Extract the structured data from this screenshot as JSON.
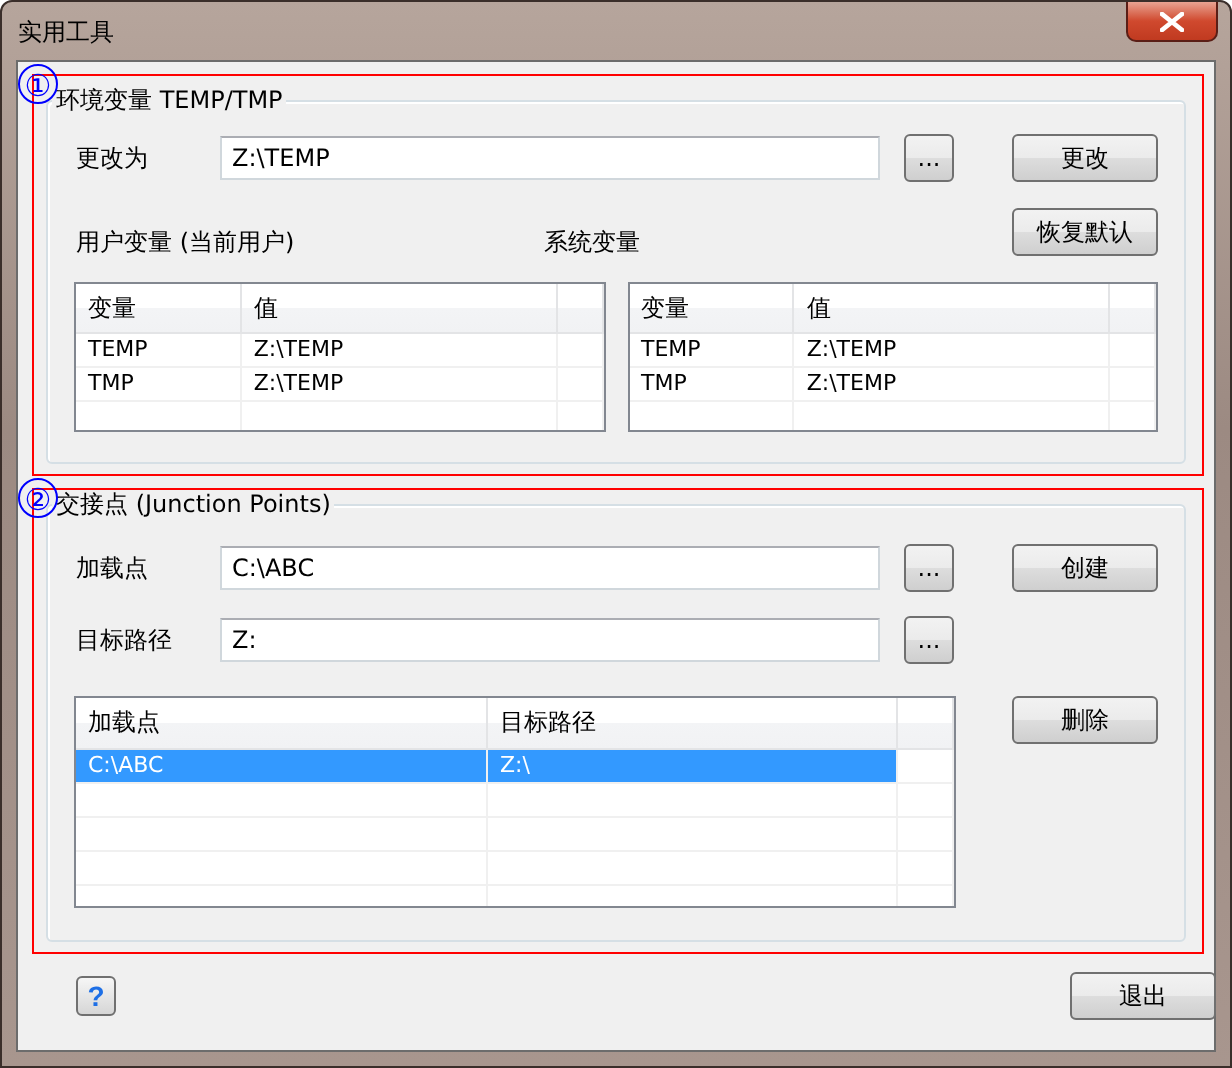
{
  "window": {
    "title": "实用工具"
  },
  "env_section": {
    "badge": "①",
    "title": "环境变量 TEMP/TMP",
    "change_field": {
      "label": "更改为",
      "value": "Z:\\TEMP",
      "browse": "..."
    },
    "change_button": "更改",
    "restore_button": "恢复默认",
    "tables": [
      {
        "label": "用户变量 (当前用户)",
        "columns": [
          "变量",
          "值"
        ],
        "rows": [
          {
            "cells": [
              "TEMP",
              "Z:\\TEMP"
            ],
            "selected": false
          },
          {
            "cells": [
              "TMP",
              "Z:\\TEMP"
            ],
            "selected": false
          }
        ]
      },
      {
        "label": "系统变量",
        "columns": [
          "变量",
          "值"
        ],
        "rows": [
          {
            "cells": [
              "TEMP",
              "Z:\\TEMP"
            ],
            "selected": false
          },
          {
            "cells": [
              "TMP",
              "Z:\\TEMP"
            ],
            "selected": false
          }
        ]
      }
    ]
  },
  "junction_section": {
    "badge": "②",
    "title": "交接点 (Junction Points)",
    "fields": [
      {
        "label": "加载点",
        "value": "C:\\ABC",
        "browse": "..."
      },
      {
        "label": "目标路径",
        "value": "Z:",
        "browse": "..."
      }
    ],
    "create_button": "创建",
    "delete_button": "删除",
    "table": {
      "columns": [
        "加载点",
        "目标路径"
      ],
      "rows": [
        {
          "cells": [
            "C:\\ABC",
            "Z:\\"
          ],
          "selected": true
        }
      ]
    }
  },
  "footer": {
    "help": "?",
    "exit_button": "退出"
  }
}
